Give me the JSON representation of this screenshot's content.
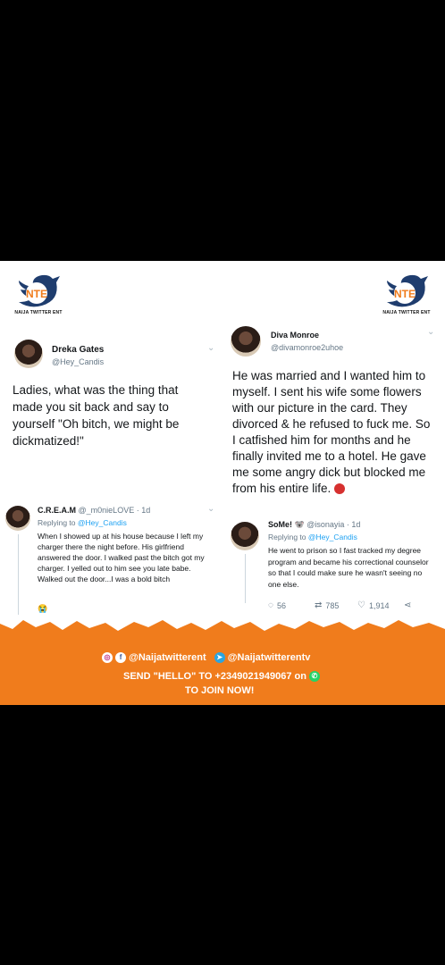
{
  "logo": {
    "letters": "NTE",
    "caption": "NAIJA TWITTER ENT"
  },
  "tweet1": {
    "name": "Dreka Gates",
    "handle": "@Hey_Candis",
    "text": "Ladies, what was the thing that made you sit back and say to yourself \"Oh bitch, we might be dickmatized!\""
  },
  "reply1": {
    "name": "C.R.E.A.M",
    "handle_time": "@_m0nieLOVE · 1d",
    "replying_label": "Replying to",
    "replying_to": "@Hey_Candis",
    "text": "When I showed up at his house because I left my charger there the night before. His girlfriend answered the door. I walked past the bitch got my charger. I yelled out to him see you late babe. Walked out the door...I was a bold bitch",
    "emoji": "😭"
  },
  "tweet2": {
    "name": "Diva Monroe",
    "handle": "@divamonroe2uhoe",
    "text": "He was married and I wanted him to myself. I sent his wife some flowers with our picture in the card. They divorced & he refused to fuck me. So I catfished him for months and he finally invited me to a hotel. He gave me some angry dick but blocked me from his entire life."
  },
  "reply2": {
    "name": "SoMe! 🐨",
    "handle_time": "@isonayia · 1d",
    "replying_label": "Replying to",
    "replying_to": "@Hey_Candis",
    "text": "He went to prison so I fast tracked my degree program and became his correctional counselor so that I could make sure he wasn't seeing no one else.",
    "stats": {
      "replies": "56",
      "retweets": "785",
      "likes": "1,914"
    }
  },
  "footer": {
    "instagram_facebook_handle": "@Naijatwitterent",
    "telegram_handle": "@Naijatwitterentv",
    "line1": "SEND \"HELLO\" TO +2349021949067 on",
    "line2": "TO JOIN NOW!"
  },
  "colors": {
    "accent": "#f07c1c",
    "twitter_blue": "#1da1f2",
    "logo_navy": "#1f3d6e"
  }
}
